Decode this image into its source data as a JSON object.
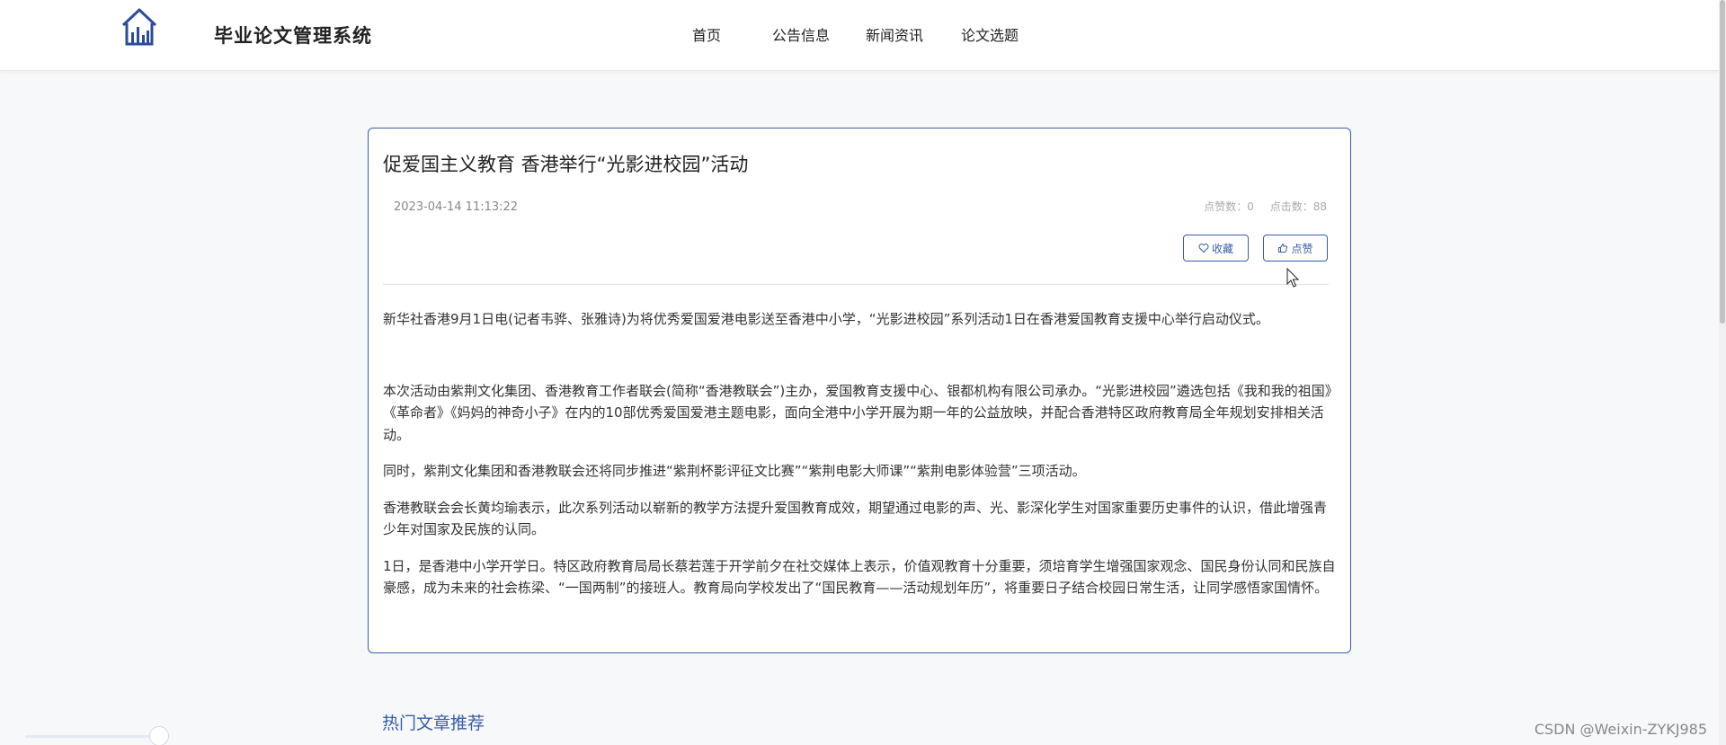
{
  "header": {
    "logo_icon": "house-chart-icon",
    "site_title": "毕业论文管理系统",
    "nav": [
      "首页",
      "公告信息",
      "新闻资讯",
      "论文选题"
    ]
  },
  "article": {
    "title": "促爱国主义教育 香港举行“光影进校园”活动",
    "date": "2023-04-14 11:13:22",
    "likes_label": "点赞数：0",
    "clicks_label": "点击数：88",
    "favorite_button": "收藏",
    "like_button": "点赞",
    "paragraphs": [
      "新华社香港9月1日电(记者韦骅、张雅诗)为将优秀爱国爱港电影送至香港中小学，“光影进校园”系列活动1日在香港爱国教育支援中心举行启动仪式。",
      "本次活动由紫荆文化集团、香港教育工作者联会(简称“香港教联会”)主办，爱国教育支援中心、银都机构有限公司承办。“光影进校园”遴选包括《我和我的祖国》《革命者》《妈妈的神奇小子》在内的10部优秀爱国爱港主题电影，面向全港中小学开展为期一年的公益放映，并配合香港特区政府教育局全年规划安排相关活动。",
      "同时，紫荆文化集团和香港教联会还将同步推进“紫荆杯影评征文比赛”“紫荆电影大师课”“紫荆电影体验营”三项活动。",
      "香港教联会会长黄均瑜表示，此次系列活动以崭新的教学方法提升爱国教育成效，期望通过电影的声、光、影深化学生对国家重要历史事件的认识，借此增强青少年对国家及民族的认同。",
      "1日，是香港中小学开学日。特区政府教育局局长蔡若莲于开学前夕在社交媒体上表示，价值观教育十分重要，须培育学生增强国家观念、国民身份认同和民族自豪感，成为未来的社会栋梁、“一国两制”的接班人。教育局向学校发出了“国民教育——活动规划年历”，将重要日子结合校园日常生活，让同学感悟家国情怀。"
    ]
  },
  "hot_section_title": "热门文章推荐",
  "watermark": "CSDN @Weixin-ZYKJ985",
  "colors": {
    "accent": "#3a5da8"
  }
}
